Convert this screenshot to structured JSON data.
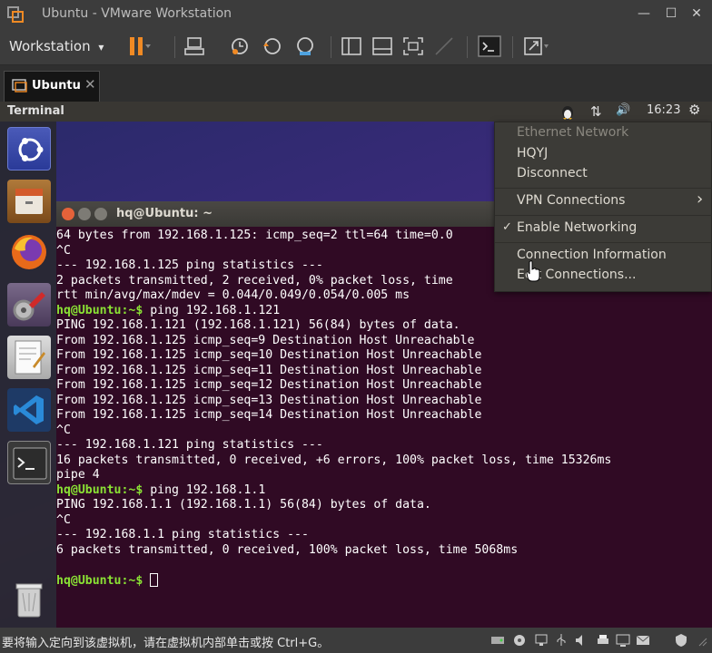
{
  "window": {
    "title": "Ubuntu - VMware Workstation",
    "minimize": "—",
    "maximize": "☐",
    "close": "✕"
  },
  "toolbar": {
    "menu_label": "Workstation",
    "menu_arrow": "▾"
  },
  "tab": {
    "label": "Ubuntu",
    "close": "✕"
  },
  "ubuntu_panel": {
    "app_title": "Terminal",
    "clock": "16:23",
    "volume_glyph": "🔊",
    "network_glyph": "⇅",
    "gear_glyph": "⚙"
  },
  "terminal": {
    "title": "hq@Ubuntu: ~",
    "lines": [
      {
        "text": "64 bytes from 192.168.1.125: icmp_seq=2 ttl=64 time=0.0"
      },
      {
        "text": "^C"
      },
      {
        "text": "--- 192.168.1.125 ping statistics ---"
      },
      {
        "text": "2 packets transmitted, 2 received, 0% packet loss, time"
      },
      {
        "text": "rtt min/avg/max/mdev = 0.044/0.049/0.054/0.005 ms"
      },
      {
        "prompt": "hq@Ubuntu:~$",
        "text": " ping 192.168.1.121"
      },
      {
        "text": "PING 192.168.1.121 (192.168.1.121) 56(84) bytes of data."
      },
      {
        "text": "From 192.168.1.125 icmp_seq=9 Destination Host Unreachable"
      },
      {
        "text": "From 192.168.1.125 icmp_seq=10 Destination Host Unreachable"
      },
      {
        "text": "From 192.168.1.125 icmp_seq=11 Destination Host Unreachable"
      },
      {
        "text": "From 192.168.1.125 icmp_seq=12 Destination Host Unreachable"
      },
      {
        "text": "From 192.168.1.125 icmp_seq=13 Destination Host Unreachable"
      },
      {
        "text": "From 192.168.1.125 icmp_seq=14 Destination Host Unreachable"
      },
      {
        "text": "^C"
      },
      {
        "text": "--- 192.168.1.121 ping statistics ---"
      },
      {
        "text": "16 packets transmitted, 0 received, +6 errors, 100% packet loss, time 15326ms"
      },
      {
        "text": "pipe 4"
      },
      {
        "prompt": "hq@Ubuntu:~$",
        "text": " ping 192.168.1.1"
      },
      {
        "text": "PING 192.168.1.1 (192.168.1.1) 56(84) bytes of data."
      },
      {
        "text": "^C"
      },
      {
        "text": "--- 192.168.1.1 ping statistics ---"
      },
      {
        "text": "6 packets transmitted, 0 received, 100% packet loss, time 5068ms"
      },
      {
        "text": ""
      },
      {
        "prompt": "hq@Ubuntu:~$",
        "text": " ",
        "cursor": true
      }
    ]
  },
  "network_menu": {
    "header": "Ethernet Network",
    "connection": "HQYJ",
    "disconnect": "Disconnect",
    "vpn": "VPN Connections",
    "vpn_arrow": "›",
    "enable_networking": "Enable Networking",
    "enable_check": "✓",
    "connection_info": "Connection Information",
    "edit_connections": "Edit Connections..."
  },
  "status_bar": {
    "message": "要将输入定向到该虚拟机，请在虚拟机内部单击或按 Ctrl+G。"
  },
  "colors": {
    "terminal_bg": "#300a24",
    "prompt": "#8ae234",
    "pause_orange": "#f08a24"
  }
}
